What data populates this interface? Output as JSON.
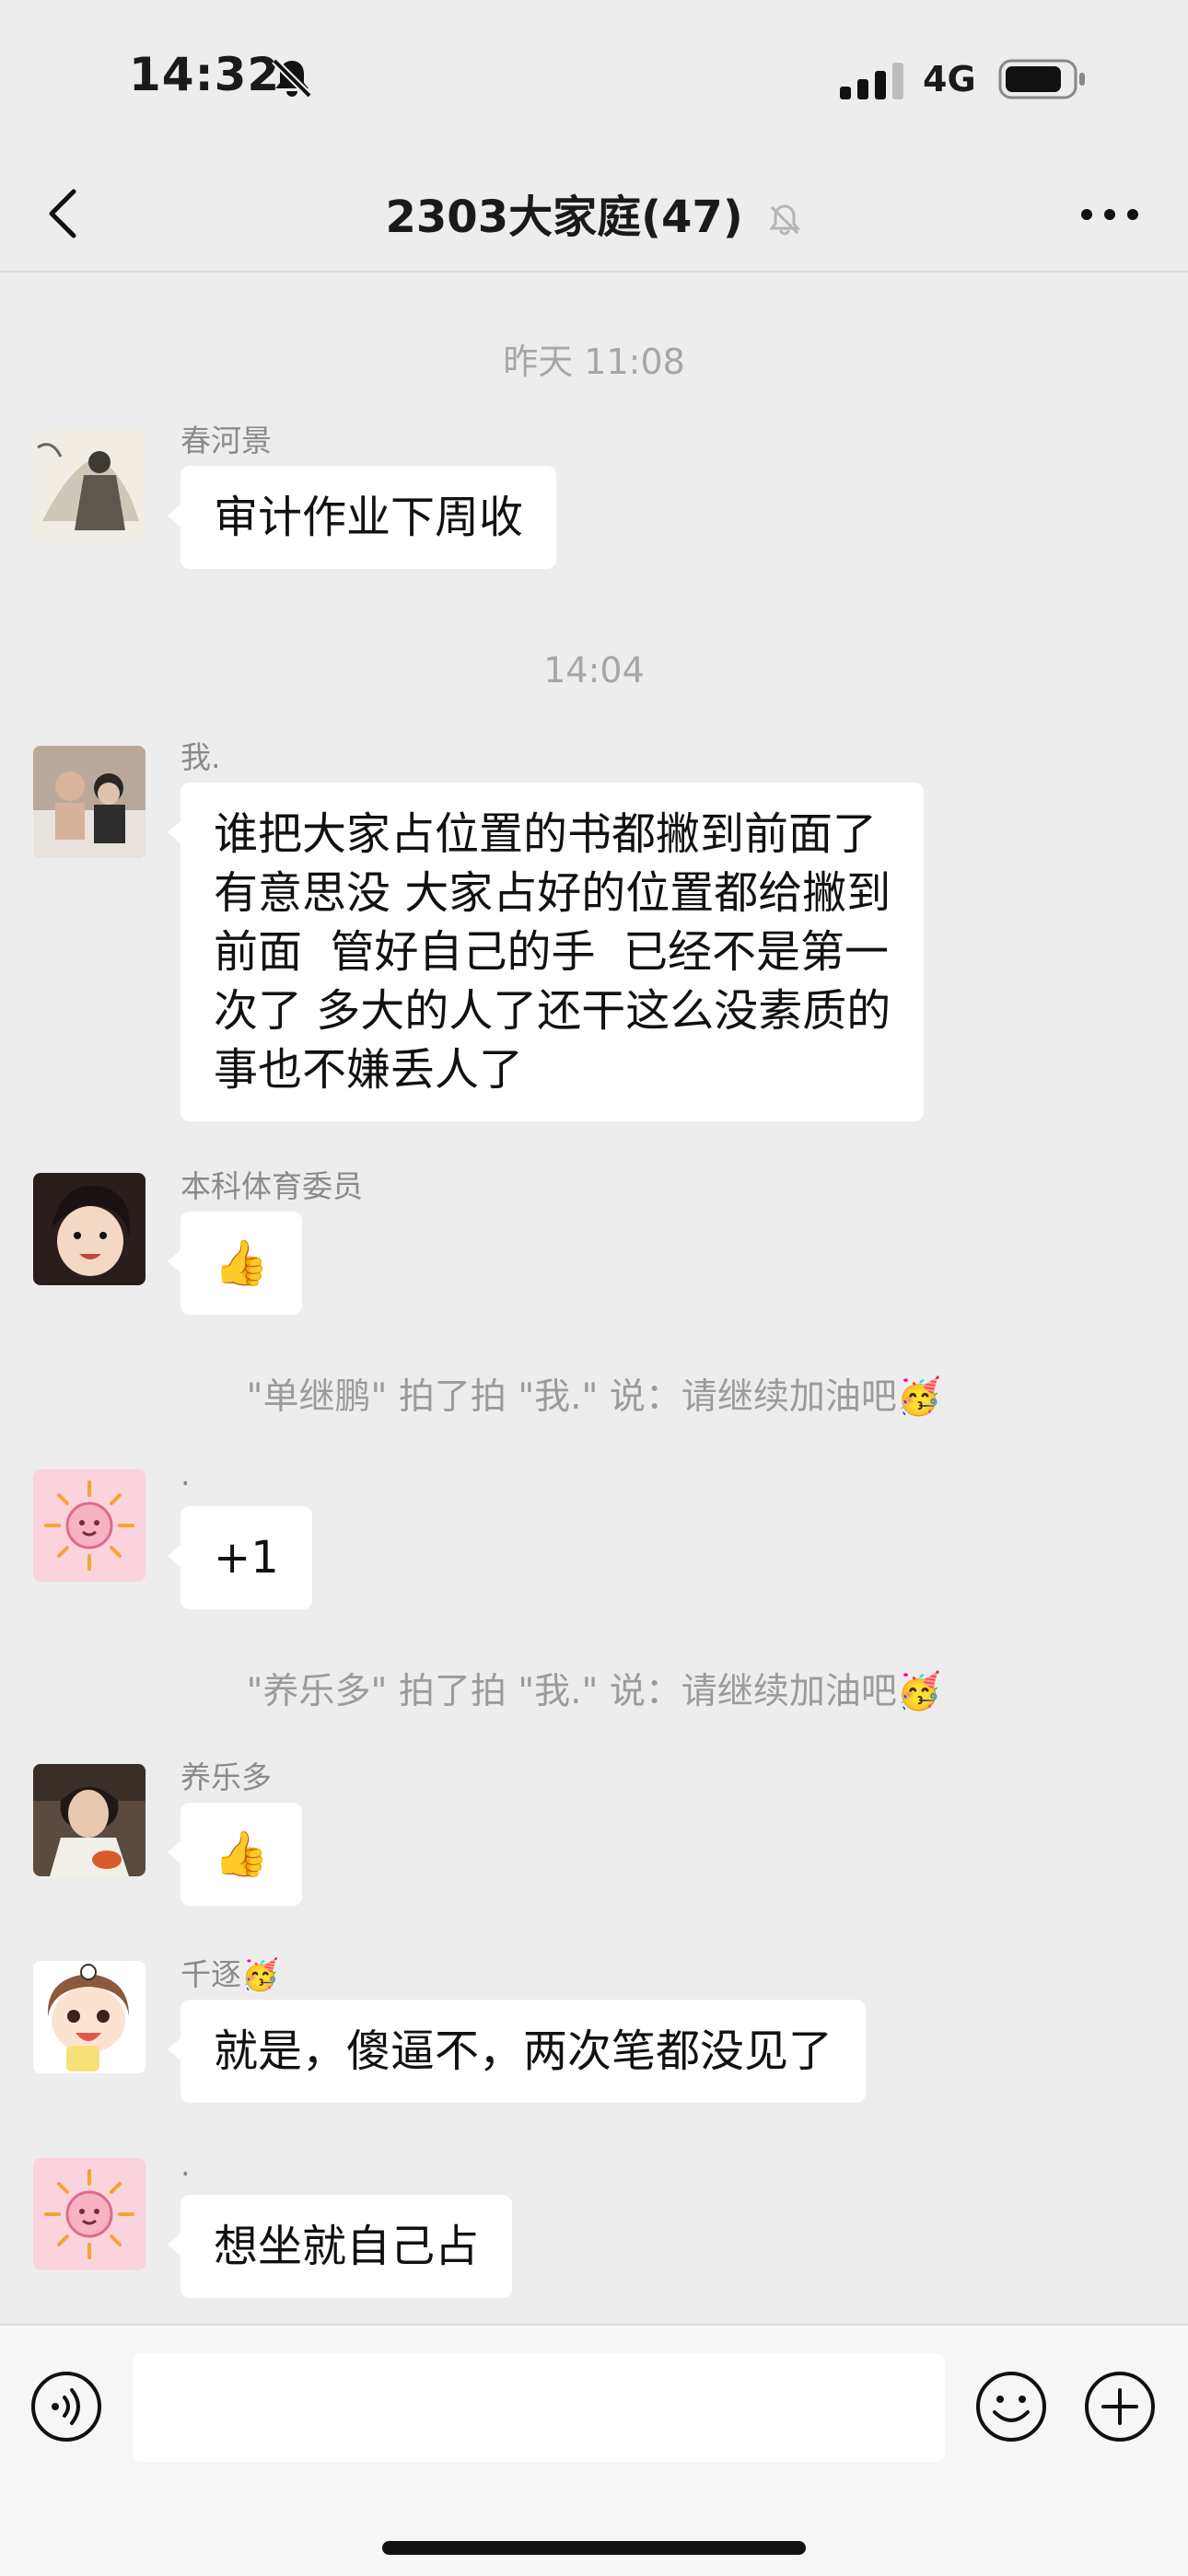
{
  "status_bar": {
    "time": "14:32",
    "network": "4G"
  },
  "header": {
    "title": "2303大家庭(47)"
  },
  "messages": [
    {
      "timestamp": "昨天 11:08"
    },
    {
      "sender": "春河景",
      "text": "审计作业下周收"
    },
    {
      "timestamp": "14:04"
    },
    {
      "sender": "我.",
      "text": "谁把大家占位置的书都撇到前面了\n有意思没 大家占好的位置都给撇到\n前面  管好自己的手  已经不是第一\n次了 多大的人了还干这么没素质的\n事也不嫌丢人了"
    },
    {
      "sender": "本科体育委员",
      "text": "👍"
    },
    {
      "system": "\"单继鹏\" 拍了拍 \"我.\" 说：请继续加油吧🥳"
    },
    {
      "sender": ".",
      "text": "+1"
    },
    {
      "system": "\"养乐多\" 拍了拍 \"我.\" 说：请继续加油吧🥳"
    },
    {
      "sender": "养乐多",
      "text": "👍"
    },
    {
      "sender": "千逐🥳",
      "text": "就是，傻逼不，两次笔都没见了"
    },
    {
      "sender": ".",
      "text": "想坐就自己占"
    }
  ],
  "input": {
    "placeholder": ""
  },
  "icons": {
    "back": "chevron-left-icon",
    "more": "more-dots-icon",
    "mute": "bell-slash-icon",
    "voice": "voice-icon",
    "emoji": "emoji-icon",
    "plus": "plus-icon"
  },
  "colors": {
    "background": "#ededed",
    "bubble": "#ffffff",
    "meta_text": "#a6a6a6"
  }
}
